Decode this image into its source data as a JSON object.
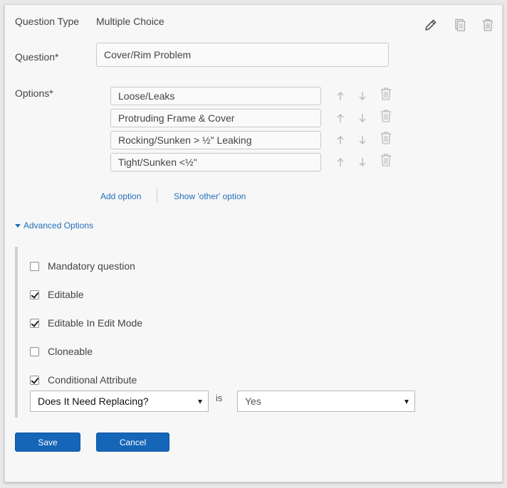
{
  "question_type": {
    "label": "Question Type",
    "value": "Multiple Choice"
  },
  "toolbar": {
    "edit_icon": "pencil-icon",
    "copy_icon": "copy-icon",
    "delete_icon": "trash-icon"
  },
  "question": {
    "label": "Question*",
    "value": "Cover/Rim Problem"
  },
  "options": {
    "label": "Options*",
    "items": [
      {
        "value": "Loose/Leaks"
      },
      {
        "value": "Protruding Frame & Cover"
      },
      {
        "value": "Rocking/Sunken > ½\" Leaking"
      },
      {
        "value": "Tight/Sunken <½\""
      }
    ],
    "add_option": "Add option",
    "show_other": "Show 'other' option"
  },
  "advanced": {
    "toggle_label": "Advanced Options",
    "checkboxes": [
      {
        "label": "Mandatory question",
        "checked": false
      },
      {
        "label": "Editable",
        "checked": true
      },
      {
        "label": "Editable In Edit Mode",
        "checked": true
      },
      {
        "label": "Cloneable",
        "checked": false
      },
      {
        "label": "Conditional Attribute",
        "checked": true
      }
    ],
    "condition": {
      "question": "Does It Need Replacing?",
      "operator": "is",
      "value": "Yes"
    }
  },
  "actions": {
    "save": "Save",
    "cancel": "Cancel"
  },
  "colors": {
    "accent": "#1565b8",
    "link": "#1f6fb7",
    "panel": "#f7f7f7"
  }
}
